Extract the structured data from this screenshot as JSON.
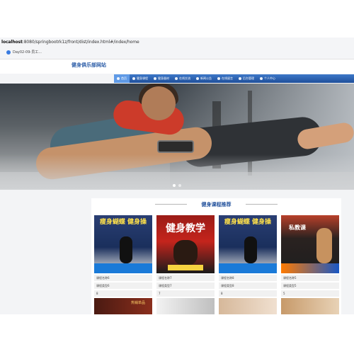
{
  "browser": {
    "address_host": "localhost",
    "address_rest": ":8080/springbootrk1z/front/dist/index.html#/index/home",
    "bookmark_label": "Day02-09-员工..."
  },
  "header": {
    "brand": "健身俱乐部网站"
  },
  "nav": {
    "items": [
      {
        "label": "首页"
      },
      {
        "label": "健身课程"
      },
      {
        "label": "健身器材"
      },
      {
        "label": "在线交流"
      },
      {
        "label": "新闻公告"
      },
      {
        "label": "在线留言"
      },
      {
        "label": "后台管理"
      },
      {
        "label": "个人中心"
      }
    ],
    "active_index": 0
  },
  "hero": {
    "slide_count": 2,
    "active_slide": 0
  },
  "section": {
    "title": "健身课程推荐",
    "cards": [
      {
        "image_caption": "瘦身蝴蝶 健身操",
        "line1": "课程名称6",
        "line2": "课程类型6",
        "line3": "8",
        "image_color": "#1a2f5c"
      },
      {
        "image_caption": "健身教学",
        "line1": "课程名称7",
        "line2": "课程类型7",
        "line3": "7",
        "image_color": "#c4241c"
      },
      {
        "image_caption": "瘦身蝴蝶 健身操",
        "line1": "课程名称8",
        "line2": "课程类型8",
        "line3": "8",
        "image_color": "#1a2f5c"
      },
      {
        "image_caption": "私教课",
        "line1": "课程名称5",
        "line2": "课程类型5",
        "line3": "5",
        "image_color": "#b8402a"
      }
    ],
    "row2": [
      {
        "image_caption": "热销单品"
      },
      {
        "image_caption": ""
      },
      {
        "image_caption": ""
      },
      {
        "image_caption": ""
      }
    ]
  }
}
